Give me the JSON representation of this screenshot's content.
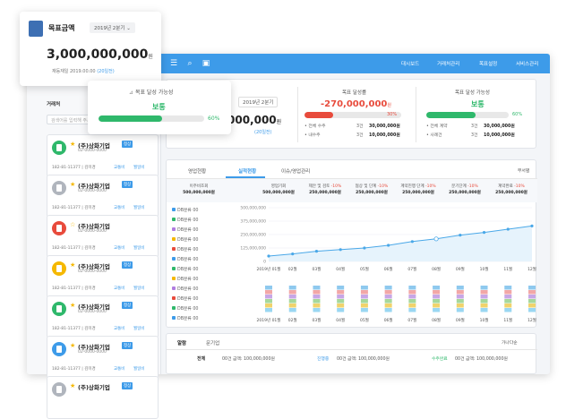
{
  "topbar": {
    "nav": [
      "대시보드",
      "거래처관리",
      "목표설정",
      "서비스관리"
    ]
  },
  "sidebar": {
    "customer_label": "거래처",
    "search_placeholder": "검색어를 입력해 주세요",
    "cards": [
      {
        "name": "(주)상화기업",
        "tag": "정상",
        "phone": "02-0000-0000",
        "line": "182-81-11377 | 김미경",
        "badge1": "교통비",
        "badge2": "월일비",
        "icon_color": "#2fb86b",
        "starred": true
      },
      {
        "name": "(주)상화기업",
        "tag": "정상",
        "phone": "02-0000-0000",
        "line": "182-81-11377 | 김미경",
        "badge1": "교통비",
        "badge2": "월일비",
        "icon_color": "#b0b5bd",
        "starred": true
      },
      {
        "name": "(주)상화기업",
        "tag": "",
        "phone": "02-0000-0000",
        "line": "182-81-11377 | 김미경",
        "badge1": "교통비",
        "badge2": "월일비",
        "icon_color": "#e84b3c",
        "starred": false
      },
      {
        "name": "(주)상화기업",
        "tag": "정상",
        "phone": "02-0000-0000",
        "line": "182-81-11377 | 김미경",
        "badge1": "교통비",
        "badge2": "월일비",
        "icon_color": "#f5b800",
        "starred": true
      },
      {
        "name": "(주)상화기업",
        "tag": "정상",
        "phone": "02-0000-0000",
        "line": "182-81-11377 | 김미경",
        "badge1": "교통비",
        "badge2": "월일비",
        "icon_color": "#2fb86b",
        "starred": true
      },
      {
        "name": "(주)상화기업",
        "tag": "정상",
        "phone": "02-0000-0000",
        "line": "182-81-11377 | 김미경",
        "badge1": "교통비",
        "badge2": "월일비",
        "icon_color": "#3d9be9",
        "starred": true
      },
      {
        "name": "(주)상화기업",
        "tag": "정상",
        "phone": "",
        "line": "",
        "badge1": "",
        "badge2": "",
        "icon_color": "#b0b5bd",
        "starred": true
      }
    ]
  },
  "float_goal": {
    "title": "목표금액",
    "period": "2019년 2분기",
    "amount": "3,000,000,000",
    "unit": "원",
    "sub": "재등재일 2019.00.00",
    "sub_highlight": "(20일전)"
  },
  "float_possibility": {
    "title": "목표 달성 가능성",
    "status": "보통",
    "percent": "60%",
    "progress": 0.6
  },
  "summary": {
    "period": "2019년 2분기",
    "amount_partial": "000,000",
    "amount_unit": "원",
    "amount_sub": "(20일전)",
    "achieve": {
      "title": "목표 달성률",
      "value": "-270,000,000",
      "unit": "원",
      "percent": "30%",
      "progress": 0.3,
      "rows": [
        {
          "k": "• 전체 수주",
          "n": "3건",
          "v": "30,000,000원"
        },
        {
          "k": "• 내수주",
          "n": "3건",
          "v": "10,000,000원"
        }
      ]
    },
    "possibility": {
      "title": "목표 달성 가능성",
      "status": "보통",
      "percent": "60%",
      "progress": 0.6,
      "rows": [
        {
          "k": "• 전체 계약",
          "n": "3건",
          "v": "30,000,000원"
        },
        {
          "k": "• 사례건",
          "n": "3건",
          "v": "10,000,000원"
        }
      ]
    }
  },
  "tabs": [
    "영업현황",
    "실적현황",
    "이슈/영업관리"
  ],
  "tab_right": "부서별",
  "table_header": [
    {
      "l1": "영업기회",
      "l2": "500,000,000원"
    },
    {
      "l1": "제안 및 검토",
      "l2": "250,000,000원",
      "pct": "-10%"
    },
    {
      "l1": "협상 및 단계",
      "l2": "250,000,000원",
      "pct": "-10%"
    },
    {
      "l1": "계약진행 단계",
      "l2": "250,000,000원",
      "pct": "-10%"
    },
    {
      "l1": "분기단계",
      "l2": "250,000,000원",
      "pct": "-10%"
    },
    {
      "l1": "계약완료",
      "l2": "250,000,000원",
      "pct": "-10%"
    }
  ],
  "left_head": {
    "l1": "이주비조회",
    "l2": "500,000,000원"
  },
  "row_labels": [
    "DB분류 00",
    "DB분류 00",
    "DB분류 00",
    "DB분류 00",
    "DB분류 00",
    "DB분류 00",
    "DB분류 00",
    "DB분류 00",
    "DB분류 00",
    "DB분류 00",
    "DB분류 00",
    "DB분류 00"
  ],
  "row_dot_colors": [
    "#3d9be9",
    "#2fb86b",
    "#b07de0",
    "#f5b800",
    "#e84b3c",
    "#3d9be9",
    "#2fb86b",
    "#f5b800",
    "#b07de0",
    "#e84b3c",
    "#2fb86b",
    "#3d9be9"
  ],
  "bottom": {
    "tab1": "알람",
    "tab2": "문기업",
    "right": "가나다순",
    "row_label": "전체",
    "row_text": "00건 금액: 100,000,000원",
    "badge1": "진행중",
    "row_text2": "00건 금액: 100,000,000원",
    "badge2": "수주완료",
    "row_text3": "00건 금액: 100,000,000원"
  },
  "chart_data": {
    "type": "line",
    "categories": [
      "2019년 01월",
      "02월",
      "03월",
      "04월",
      "05월",
      "06월",
      "07월",
      "08월",
      "09월",
      "10월",
      "11월",
      "12월"
    ],
    "series": [
      {
        "values": [
          50000000,
          70000000,
          95000000,
          110000000,
          125000000,
          150000000,
          185000000,
          210000000,
          245000000,
          270000000,
          300000000,
          330000000
        ]
      }
    ],
    "ylabels": [
      "500,000,000",
      "375,000,000",
      "250,000,000",
      "125,000,000",
      "0"
    ],
    "ylim": [
      0,
      500000000
    ],
    "stacked_bar_colors": [
      "#9ad7f2",
      "#f0d36b",
      "#a6d89b",
      "#c7a6e6",
      "#f2a7a7",
      "#8ec9ee"
    ]
  }
}
